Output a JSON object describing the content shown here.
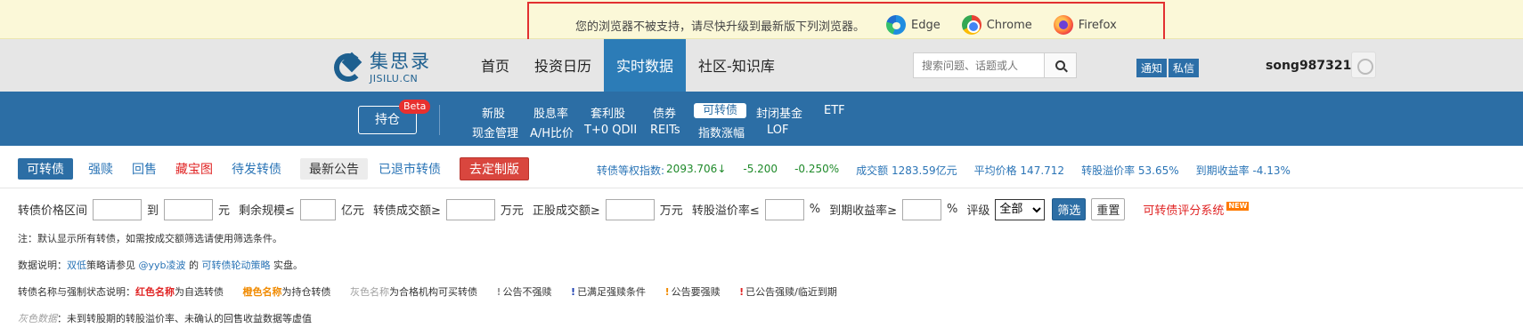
{
  "browser_warning": {
    "message": "您的浏览器不被支持，请尽快升级到最新版下列浏览器。",
    "browsers": [
      "Edge",
      "Chrome",
      "Firefox"
    ]
  },
  "header": {
    "logo_cn": "集思录",
    "logo_en": "JISILU.CN",
    "nav": [
      "首页",
      "投资日历",
      "实时数据",
      "社区-知识库"
    ],
    "active_nav": "实时数据",
    "search_placeholder": "搜索问题、话题或人",
    "badges": [
      "通知",
      "私信"
    ],
    "username": "song987321"
  },
  "subnav": {
    "hold_button": "持仓",
    "beta_badge": "Beta",
    "row1": [
      "新股",
      "股息率",
      "套利股",
      "债券",
      "可转债",
      "封闭基金",
      "ETF"
    ],
    "row2": [
      "现金管理",
      "A/H比价",
      "T+0 QDII",
      "REITs",
      "指数涨幅",
      "LOF"
    ],
    "active": "可转债"
  },
  "tabs": {
    "items": [
      "可转债",
      "强赎",
      "回售",
      "藏宝图",
      "待发转债",
      "最新公告",
      "已退市转债",
      "去定制版"
    ]
  },
  "stats": {
    "index_label": "转债等权指数:",
    "index_value": "2093.706",
    "index_arrow": "↓",
    "change": "-5.200",
    "change_pct": "-0.250%",
    "volume": "成交额 1283.59亿元",
    "avg_price": "平均价格 147.712",
    "premium": "转股溢价率 53.65%",
    "ytm": "到期收益率 -4.13%"
  },
  "filters": {
    "price_label": "转债价格区间",
    "to": "到",
    "yuan": "元",
    "remaining_label": "剩余规模≤",
    "yi_yuan": "亿元",
    "cb_volume_label": "转债成交额≥",
    "wan_yuan": "万元",
    "stock_volume_label": "正股成交额≥",
    "premium_label": "转股溢价率≤",
    "pct": "%",
    "ytm_label": "到期收益率≥",
    "rating_label": "评级",
    "rating_selected": "全部",
    "filter_button": "筛选",
    "reset_button": "重置",
    "score_link": "可转债评分系统",
    "new_badge": "NEW"
  },
  "notes": {
    "line1": "注：默认显示所有转债，如需按成交额筛选请使用筛选条件。",
    "line2_prefix": "数据说明：",
    "line2_link1": "双低",
    "line2_mid1": "策略请参见 ",
    "line2_link2": "@yyb凌波",
    "line2_mid2": " 的 ",
    "line2_link3": "可转债轮动策略",
    "line2_suffix": " 实盘。",
    "line3_prefix": "转债名称与强制状态说明：",
    "line3_red": "红色名称",
    "line3_red_desc": "为自选转债",
    "line3_orange": "橙色名称",
    "line3_orange_desc": "为持仓转债",
    "line3_gray": "灰色名称",
    "line3_gray_desc": "为合格机构可买转债",
    "m1": "公告不强赎",
    "m2": "已满足强赎条件",
    "m3": "公告要强赎",
    "m4": "已公告强赎/临近到期",
    "line4_gray": "灰色数据",
    "line4_desc": "：未到转股期的转股溢价率、未确认的回售收益数据等虚值"
  },
  "colors": {
    "brand_blue": "#2c6ea5",
    "nav_active": "#2c7cb7",
    "warning_border": "#e23030",
    "red": "#e02424",
    "orange": "#f08a00",
    "green": "#1f8a2a"
  }
}
